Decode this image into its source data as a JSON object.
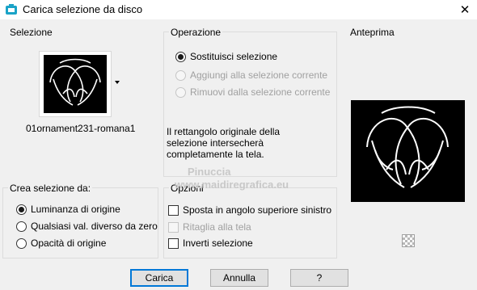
{
  "window": {
    "title": "Carica selezione da disco",
    "close_glyph": "✕"
  },
  "selezione": {
    "label": "Selezione",
    "filename": "01ornament231-romana1"
  },
  "operazione": {
    "label": "Operazione",
    "options": [
      {
        "label": "Sostituisci selezione",
        "checked": true,
        "enabled": true
      },
      {
        "label": "Aggiungi alla selezione corrente",
        "checked": false,
        "enabled": false
      },
      {
        "label": "Rimuovi dalla selezione corrente",
        "checked": false,
        "enabled": false
      }
    ],
    "note": "Il rettangolo originale della selezione intersecherà completamente la tela."
  },
  "anteprima": {
    "label": "Anteprima"
  },
  "crea_selezione": {
    "label": "Crea selezione da:",
    "options": [
      {
        "label": "Luminanza di origine",
        "checked": true
      },
      {
        "label": "Qualsiasi val. diverso da zero",
        "checked": false
      },
      {
        "label": "Opacità di origine",
        "checked": false
      }
    ]
  },
  "opzioni": {
    "label": "Opzioni",
    "options": [
      {
        "label": "Sposta in angolo superiore sinistro",
        "checked": false,
        "enabled": true
      },
      {
        "label": "Ritaglia alla tela",
        "checked": false,
        "enabled": false
      },
      {
        "label": "Inverti selezione",
        "checked": false,
        "enabled": true
      }
    ]
  },
  "buttons": {
    "ok": "Carica",
    "cancel": "Annulla",
    "help": "?"
  },
  "watermark": {
    "line1": "Pinuccia",
    "line2": "www.maidiregrafica.eu"
  }
}
